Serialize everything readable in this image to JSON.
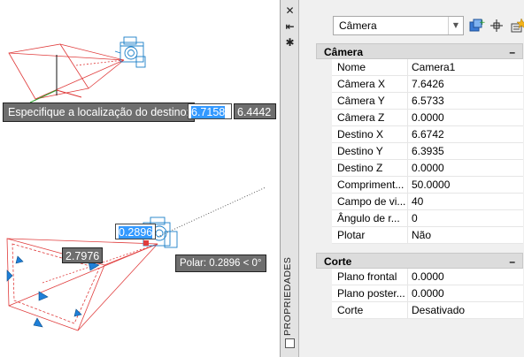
{
  "dynamic_input": {
    "prompt": "Especifique a localização do destino:",
    "x_value": "6.7158",
    "y_value": "6.4442",
    "distance_value": "0.2896",
    "second_distance": "2.7976",
    "polar_tooltip": "Polar: 0.2896 < 0°"
  },
  "palette": {
    "title": "PROPRIEDADES",
    "object_selector": "Câmera",
    "categories": [
      {
        "label": "Câmera",
        "toggle": "–",
        "rows": [
          {
            "name": "Nome",
            "value": "Camera1"
          },
          {
            "name": "Câmera X",
            "value": "7.6426"
          },
          {
            "name": "Câmera Y",
            "value": "6.5733"
          },
          {
            "name": "Câmera Z",
            "value": "0.0000"
          },
          {
            "name": "Destino X",
            "value": "6.6742"
          },
          {
            "name": "Destino Y",
            "value": "6.3935"
          },
          {
            "name": "Destino Z",
            "value": "0.0000"
          },
          {
            "name": "Compriment...",
            "value": "50.0000"
          },
          {
            "name": "Campo de vi...",
            "value": "40"
          },
          {
            "name": "Ângulo de r...",
            "value": "0"
          },
          {
            "name": "Plotar",
            "value": "Não"
          }
        ]
      },
      {
        "label": "Corte",
        "toggle": "–",
        "rows": [
          {
            "name": "Plano frontal",
            "value": "0.0000"
          },
          {
            "name": "Plano poster...",
            "value": "0.0000"
          },
          {
            "name": "Corte",
            "value": "Desativado"
          }
        ]
      }
    ]
  },
  "colors": {
    "frustum": "#e03c3c",
    "camera_glyph": "#1a7fc8",
    "grip": "#1e7fd8",
    "selection": "#3399ff"
  }
}
